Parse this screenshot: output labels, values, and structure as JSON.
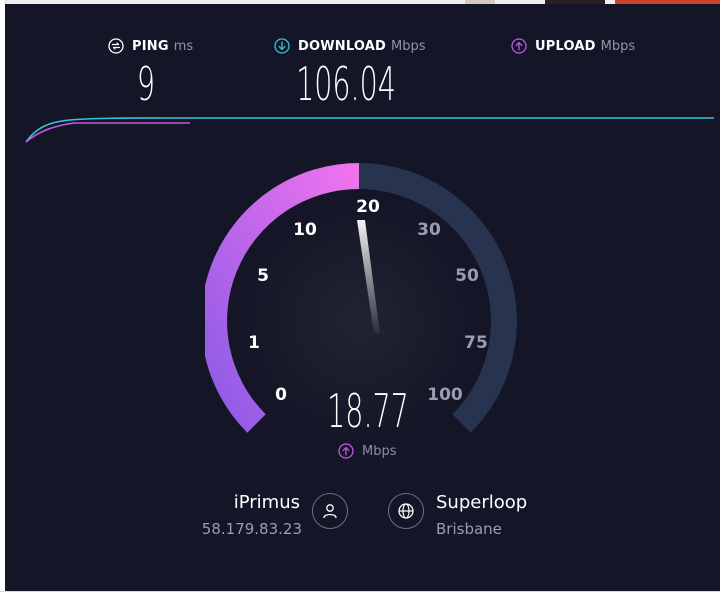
{
  "theme": {
    "panel_bg": "#141526",
    "download_accent": "#34c6d8",
    "upload_accent": "#c05ae3",
    "gauge_active_start": "#8c5ae6",
    "gauge_active_end": "#e678f0",
    "gauge_track": "#27334f"
  },
  "metrics": {
    "ping": {
      "icon": "ping-icon",
      "label": "PING",
      "unit": "ms",
      "value": "9"
    },
    "download": {
      "icon": "download-arrow-icon",
      "label": "DOWNLOAD",
      "unit": "Mbps",
      "value": "106.04"
    },
    "upload": {
      "icon": "upload-arrow-icon",
      "label": "UPLOAD",
      "unit": "Mbps"
    }
  },
  "gauge": {
    "ticks": [
      "0",
      "1",
      "5",
      "10",
      "20",
      "30",
      "50",
      "75",
      "100"
    ],
    "current_value": "18.77",
    "current_numeric": 18.77,
    "unit": "Mbps",
    "unit_icon": "upload-arrow-icon"
  },
  "provider": {
    "name": "iPrimus",
    "ip": "58.179.83.23",
    "icon": "user-icon"
  },
  "server": {
    "name": "Superloop",
    "location": "Brisbane",
    "icon": "globe-icon"
  }
}
